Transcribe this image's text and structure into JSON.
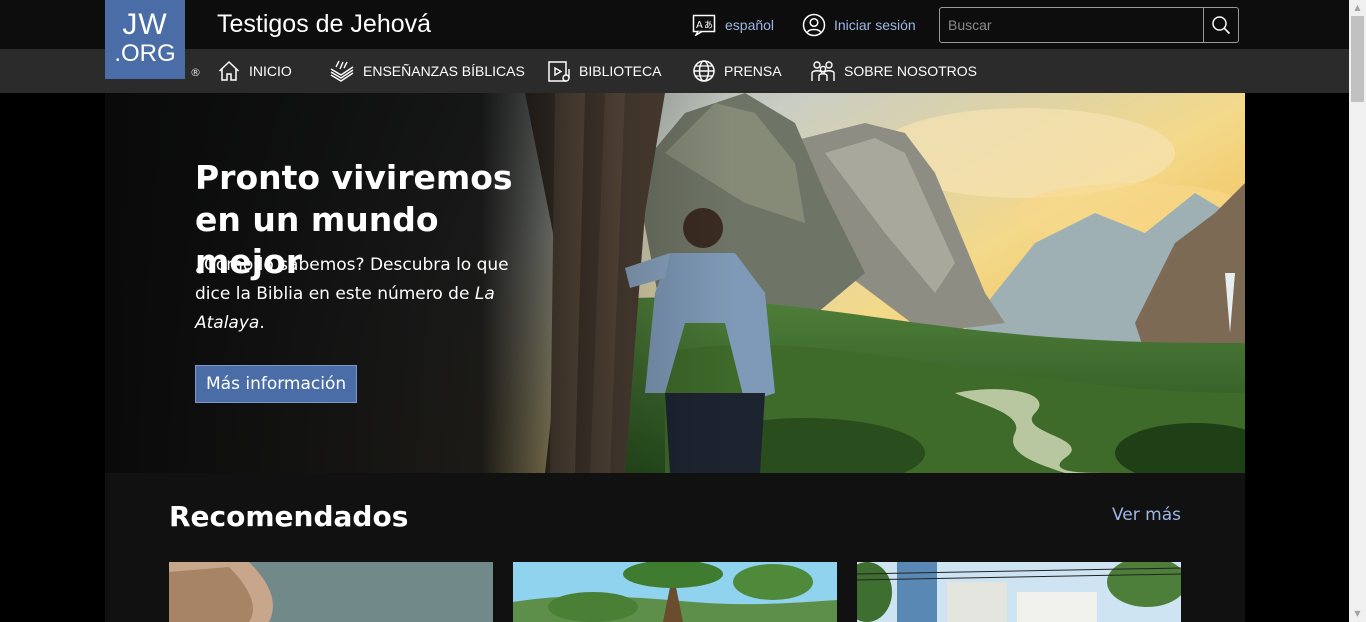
{
  "header": {
    "logo_line1": "JW",
    "logo_line2": ".ORG",
    "registered": "®",
    "site_title": "Testigos de Jehová",
    "language_label": "español",
    "login_label": "Iniciar sesión",
    "search_placeholder": "Buscar"
  },
  "nav": {
    "items": [
      {
        "label": "INICIO",
        "icon": "home-icon"
      },
      {
        "label": "ENSEÑANZAS BÍBLICAS",
        "icon": "open-bible-icon"
      },
      {
        "label": "BIBLIOTECA",
        "icon": "library-icon"
      },
      {
        "label": "PRENSA",
        "icon": "globe-icon"
      },
      {
        "label": "SOBRE NOSOTROS",
        "icon": "people-icon"
      }
    ]
  },
  "hero": {
    "title": "Pronto viviremos en un mundo mejor",
    "desc_prefix": "¿Cómo lo sabemos? Descubra lo que dice la Biblia en este número de ",
    "desc_emphasis": "La Atalaya",
    "desc_suffix": ".",
    "cta_label": "Más información"
  },
  "recommended": {
    "title": "Recomendados",
    "more_label": "Ver más"
  },
  "colors": {
    "brand_blue": "#4a6da7",
    "link_blue": "#9fb6e5",
    "header_bg": "#0d0d0d",
    "nav_bg": "#2b2b2b"
  }
}
